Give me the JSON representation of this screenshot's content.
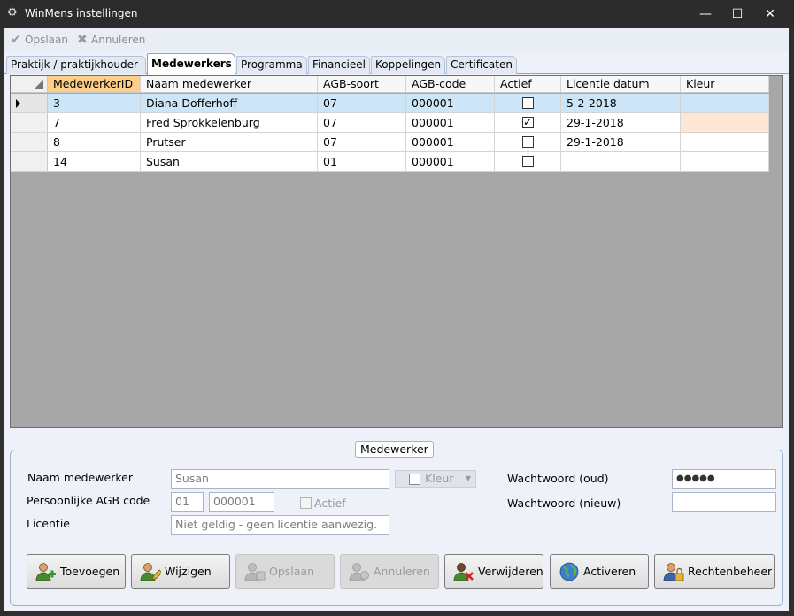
{
  "window": {
    "title": "WinMens instellingen",
    "minimize": "—",
    "maximize": "☐",
    "close": "✕"
  },
  "toolbar": {
    "save_label": "Opslaan",
    "cancel_label": "Annuleren"
  },
  "tabs": [
    {
      "label": "Praktijk / praktijkhouder"
    },
    {
      "label": "Medewerkers"
    },
    {
      "label": "Programma"
    },
    {
      "label": "Financieel"
    },
    {
      "label": "Koppelingen"
    },
    {
      "label": "Certificaten"
    }
  ],
  "grid": {
    "columns": [
      "MedewerkerID",
      "Naam medewerker",
      "AGB-soort",
      "AGB-code",
      "Actief",
      "Licentie datum",
      "Kleur"
    ],
    "sorted_column": "MedewerkerID",
    "rows": [
      {
        "id": "3",
        "naam": "Diana Dofferhoff",
        "soort": "07",
        "code": "000001",
        "actief": false,
        "datum": "5-2-2018",
        "kleur": ""
      },
      {
        "id": "7",
        "naam": "Fred Sprokkelenburg",
        "soort": "07",
        "code": "000001",
        "actief": true,
        "datum": "29-1-2018",
        "kleur": "#fde6d4"
      },
      {
        "id": "8",
        "naam": "Prutser",
        "soort": "07",
        "code": "000001",
        "actief": false,
        "datum": "29-1-2018",
        "kleur": ""
      },
      {
        "id": "14",
        "naam": "Susan",
        "soort": "01",
        "code": "000001",
        "actief": false,
        "datum": "",
        "kleur": ""
      }
    ],
    "selected_row": 0
  },
  "form": {
    "group_title": "Medewerker",
    "naam_label": "Naam medewerker",
    "naam_value": "Susan",
    "kleur_label": "Kleur",
    "agb_label": "Persoonlijke AGB code",
    "agb_soort": "01",
    "agb_code": "000001",
    "actief_label": "Actief",
    "licentie_label": "Licentie",
    "licentie_value": "Niet geldig - geen licentie aanwezig.",
    "ww_oud_label": "Wachtwoord (oud)",
    "ww_oud_value": "●●●●●",
    "ww_nieuw_label": "Wachtwoord (nieuw)",
    "ww_nieuw_value": ""
  },
  "buttons": {
    "toevoegen": "Toevoegen",
    "wijzigen": "Wijzigen",
    "opslaan": "Opslaan",
    "annuleren": "Annuleren",
    "verwijderen": "Verwijderen",
    "activeren": "Activeren",
    "rechtenbeheer": "Rechtenbeheer"
  }
}
